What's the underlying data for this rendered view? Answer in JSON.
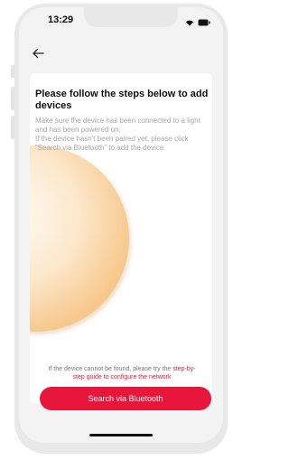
{
  "status_bar": {
    "time": "13:29",
    "icons": [
      "wifi-icon",
      "battery-icon"
    ]
  },
  "nav": {
    "back_icon": "back-arrow-icon"
  },
  "content": {
    "title": "Please follow the steps below to add devices",
    "description_line1": "Make sure the device has been connected to a light and has been powered on;",
    "description_line2": "If the device hasn't been paired yet, please click “Search via Bluetooth” to add the device"
  },
  "footer": {
    "hint_prefix": "If the device cannot be found, please try the ",
    "hint_link": "step-by-step guide to configure the network",
    "button_label": "Search via Bluetooth"
  },
  "colors": {
    "accent": "#e8163a",
    "background": "#f3f3f3",
    "card": "#ffffff",
    "glow": "#f7c98e"
  }
}
